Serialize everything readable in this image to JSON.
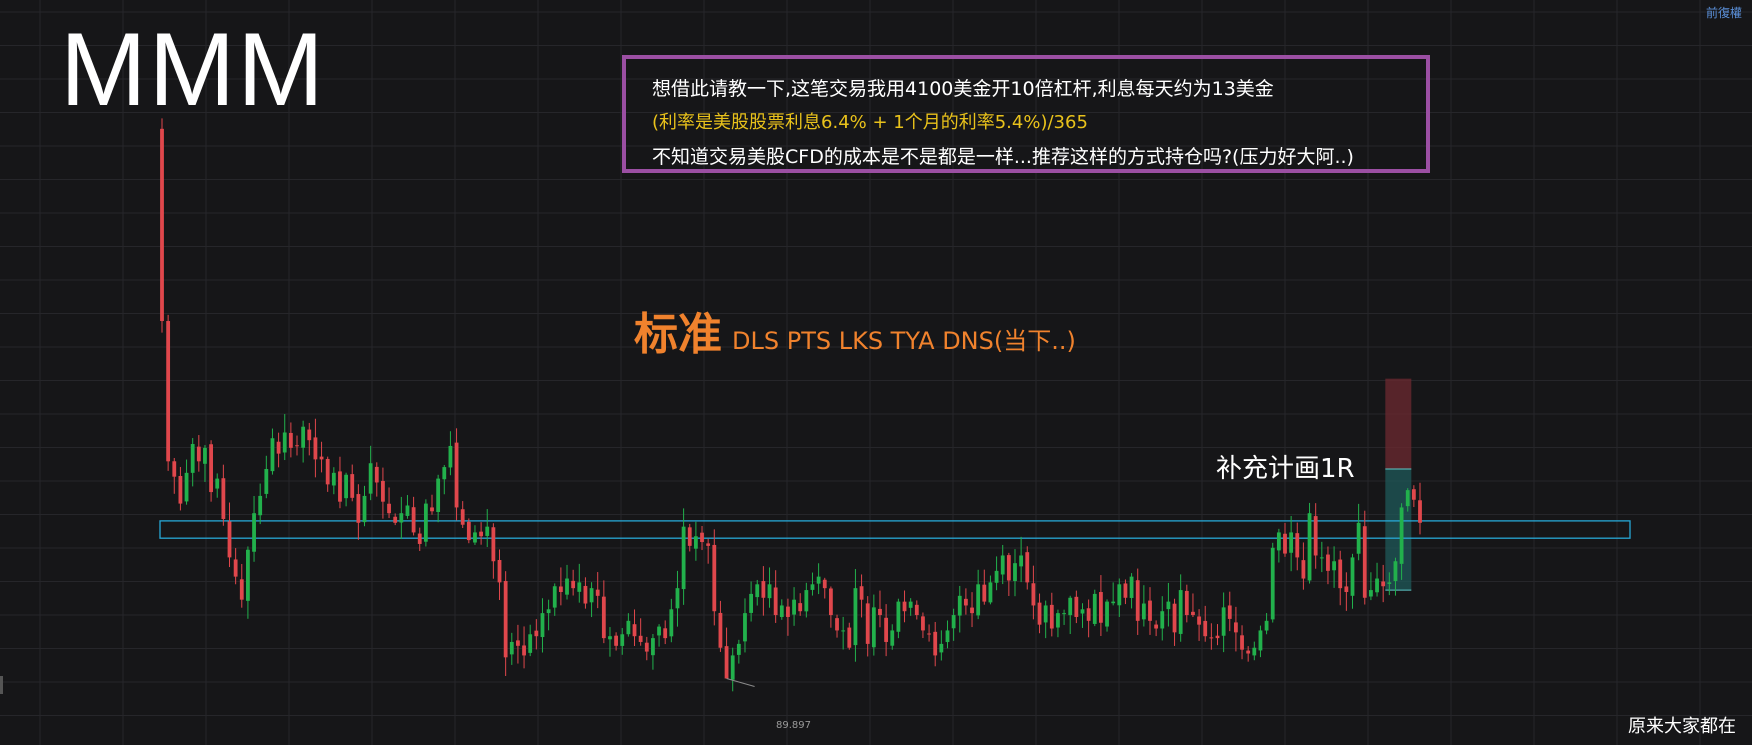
{
  "ticker": "MMM",
  "top_right_text": "前復權",
  "note_box": {
    "line1": "想借此请教一下,这笔交易我用4100美金开10倍杠杆,利息每天约为13美金",
    "line2": "(利率是美股股票利息6.4% + 1个月的利率5.4%)/365",
    "line3": "不知道交易美股CFD的成本是不是都是一样...推荐这样的方式持仓吗?(压力好大阿..)"
  },
  "standard_label": {
    "main": "标准",
    "sub": "DLS PTS LKS TYA DNS(当下..)"
  },
  "plan_label": "补充计画1R",
  "bottom_right_text": "原来大家都在",
  "low_price_label": "89.897",
  "colors": {
    "background": "#161618",
    "grid": "#26262a",
    "up": "#22b14c",
    "down": "#e0474c",
    "zone": "#27a8d6",
    "note_border": "#9b4fa3",
    "orange": "#f0822d",
    "yellow": "#e9c21b",
    "stop_zone": "#6e2a30",
    "target_zone": "#1f5a5a"
  },
  "chart_data": {
    "type": "candlestick",
    "title": "MMM",
    "price_range": [
      88,
      120
    ],
    "zone": {
      "low": 97.2,
      "high": 98.1
    },
    "low_marker": 89.897,
    "position": {
      "entry": 94.5,
      "target": 100.8,
      "stop": 105.5
    },
    "closes": [
      108.5,
      101.2,
      100.4,
      99.0,
      100.6,
      102.1,
      101.2,
      101.9,
      99.6,
      100.3,
      98.2,
      96.2,
      95.2,
      94.0,
      96.6,
      98.5,
      99.4,
      100.8,
      102.4,
      101.6,
      102.7,
      101.9,
      102.0,
      103.0,
      102.3,
      101.3,
      101.3,
      100.0,
      100.6,
      99.1,
      100.5,
      99.3,
      98.0,
      99.4,
      101.1,
      100.1,
      99.1,
      98.5,
      98.0,
      98.5,
      98.9,
      97.5,
      96.9,
      99.0,
      98.6,
      100.3,
      100.9,
      102.0,
      98.8,
      97.9,
      97.1,
      97.5,
      97.3,
      97.8,
      96.0,
      94.9,
      91.0,
      91.8,
      91.6,
      91.1,
      92.2,
      92.1,
      93.3,
      93.5,
      94.7,
      94.4,
      95.1,
      94.6,
      94.9,
      93.8,
      94.6,
      94.2,
      92.0,
      92.1,
      91.6,
      92.2,
      92.9,
      92.1,
      91.8,
      91.3,
      92.0,
      92.6,
      92.0,
      93.5,
      94.6,
      97.8,
      96.8,
      97.3,
      97.0,
      96.8,
      93.4,
      91.5,
      89.9,
      91.1,
      91.7,
      93.3,
      94.3,
      94.8,
      94.1,
      94.8,
      93.2,
      93.7,
      93.1,
      94.0,
      93.4,
      94.5,
      94.8,
      95.2,
      94.6,
      93.2,
      92.4,
      92.4,
      91.5,
      94.6,
      94.0,
      91.7,
      93.6,
      93.2,
      91.8,
      92.4,
      93.9,
      93.4,
      93.9,
      93.2,
      92.4,
      92.2,
      91.1,
      91.7,
      92.4,
      93.2,
      94.2,
      93.7,
      93.3,
      94.8,
      93.9,
      94.9,
      95.5,
      96.3,
      95.0,
      95.9,
      96.3,
      94.9,
      93.7,
      92.7,
      93.7,
      92.5,
      93.3,
      93.3,
      94.1,
      93.1,
      93.5,
      92.9,
      94.3,
      92.8,
      93.9,
      93.9,
      94.8,
      94.1,
      95.2,
      92.9,
      93.8,
      92.9,
      92.5,
      93.4,
      93.9,
      92.3,
      94.5,
      93.2,
      93.2,
      92.7,
      92.1,
      92.0,
      92.0,
      93.6,
      93.0,
      92.3,
      91.4,
      91.2,
      91.5,
      92.4,
      92.9,
      96.7,
      97.5,
      96.4,
      97.5,
      96.2,
      95.1,
      98.5,
      96.3,
      96.2,
      95.5,
      96.0,
      94.6,
      94.4,
      96.2,
      98.0,
      94.1,
      94.5,
      95.1,
      94.7,
      94.9,
      96.0,
      98.8,
      99.7,
      99.2,
      98.0
    ]
  }
}
